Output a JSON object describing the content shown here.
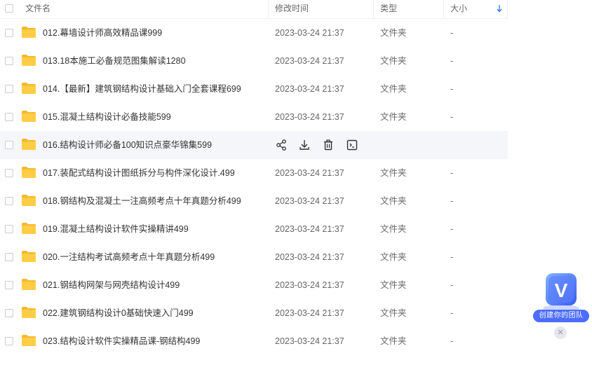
{
  "columns": {
    "name": "文件名",
    "modified": "修改时间",
    "type": "类型",
    "size": "大小"
  },
  "rows": [
    {
      "name": "012.幕墙设计师高效精品课999",
      "modified": "2023-03-24 21:37",
      "type": "文件夹",
      "size": "-"
    },
    {
      "name": "013.18本施工必备规范图集解读1280",
      "modified": "2023-03-24 21:37",
      "type": "文件夹",
      "size": "-"
    },
    {
      "name": "014.【最新】建筑钢结构设计基础入门全套课程699",
      "modified": "2023-03-24 21:37",
      "type": "文件夹",
      "size": "-"
    },
    {
      "name": "015.混凝土结构设计必备技能599",
      "modified": "2023-03-24 21:37",
      "type": "文件夹",
      "size": "-"
    },
    {
      "name": "016.结构设计师必备100知识点豪华锦集599",
      "modified": "",
      "type": "",
      "size": ""
    },
    {
      "name": "017.装配式结构设计图纸拆分与构件深化设计.499",
      "modified": "2023-03-24 21:37",
      "type": "文件夹",
      "size": "-"
    },
    {
      "name": "018.钢结构及混凝土一注高频考点十年真题分析499",
      "modified": "2023-03-24 21:37",
      "type": "文件夹",
      "size": "-"
    },
    {
      "name": "019.混凝土结构设计软件实操精讲499",
      "modified": "2023-03-24 21:37",
      "type": "文件夹",
      "size": "-"
    },
    {
      "name": "020.一注结构考试高频考点十年真题分析499",
      "modified": "2023-03-24 21:37",
      "type": "文件夹",
      "size": "-"
    },
    {
      "name": "021.钢结构网架与网壳结构设计499",
      "modified": "2023-03-24 21:37",
      "type": "文件夹",
      "size": "-"
    },
    {
      "name": "022.建筑钢结构设计0基础快速入门499",
      "modified": "2023-03-24 21:37",
      "type": "文件夹",
      "size": "-"
    },
    {
      "name": "023.结构设计软件实操精品课-钢结构499",
      "modified": "2023-03-24 21:37",
      "type": "文件夹",
      "size": "-"
    }
  ],
  "hovered_row_index": 4,
  "row_action_icons": [
    "share-icon",
    "download-icon",
    "delete-icon",
    "open-terminal-icon"
  ],
  "promo": {
    "label": "创建你的团队",
    "logo_letter": "V"
  },
  "colors": {
    "folder": "#ffcd45",
    "folder_back": "#f5b82a",
    "accent": "#3d7cf5",
    "promo": "#4c6dff"
  }
}
